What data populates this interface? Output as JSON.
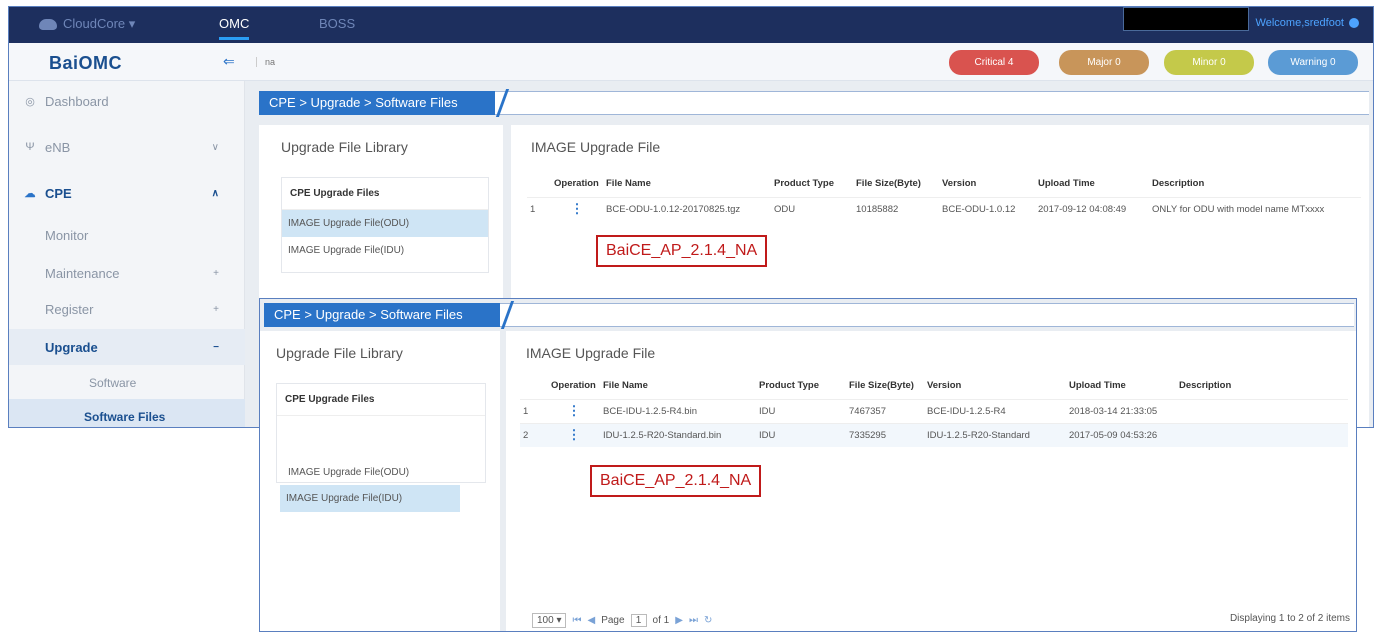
{
  "topbar": {
    "cloudcore": "CloudCore ▾",
    "omc": "OMC",
    "boss": "BOSS",
    "welcome": "Welcome,sredfoot"
  },
  "header": {
    "brand": "BaiOMC",
    "na": "na"
  },
  "alarms": [
    {
      "label": "Critical 4",
      "color": "#d9534f"
    },
    {
      "label": "Major 0",
      "color": "#c8955a"
    },
    {
      "label": "Minor 0",
      "color": "#c4c94a"
    },
    {
      "label": "Warning 0",
      "color": "#5b9bd5"
    }
  ],
  "sidebar": {
    "dashboard": "Dashboard",
    "enb": "eNB",
    "cpe": "CPE",
    "monitor": "Monitor",
    "maintenance": "Maintenance",
    "register": "Register",
    "upgrade": "Upgrade",
    "software": "Software",
    "software_files": "Software Files"
  },
  "breadcrumb": "CPE > Upgrade > Software Files",
  "library": {
    "title": "Upgrade File Library",
    "files_header": "CPE Upgrade Files",
    "item_odu": "IMAGE Upgrade File(ODU)",
    "item_idu": "IMAGE Upgrade File(IDU)"
  },
  "image_title": "IMAGE Upgrade File",
  "columns": [
    "Operation",
    "File Name",
    "Product Type",
    "File Size(Byte)",
    "Version",
    "Upload Time",
    "Description"
  ],
  "odu_rows": [
    {
      "no": "1",
      "name": "BCE-ODU-1.0.12-20170825.tgz",
      "type": "ODU",
      "size": "10185882",
      "version": "BCE-ODU-1.0.12",
      "time": "2017-09-12 04:08:49",
      "desc": "ONLY for ODU with model name MTxxxx"
    }
  ],
  "idu_rows": [
    {
      "no": "1",
      "name": "BCE-IDU-1.2.5-R4.bin",
      "type": "IDU",
      "size": "7467357",
      "version": "BCE-IDU-1.2.5-R4",
      "time": "2018-03-14 21:33:05",
      "desc": ""
    },
    {
      "no": "2",
      "name": "IDU-1.2.5-R20-Standard.bin",
      "type": "IDU",
      "size": "7335295",
      "version": "IDU-1.2.5-R20-Standard",
      "time": "2017-05-09 04:53:26",
      "desc": ""
    }
  ],
  "annotation": "BaiCE_AP_2.1.4_NA",
  "pager": {
    "page_size": "100 ▾",
    "page_label": "Page",
    "page": "1",
    "of": "of 1",
    "display": "Displaying 1 to 2 of 2 items"
  }
}
